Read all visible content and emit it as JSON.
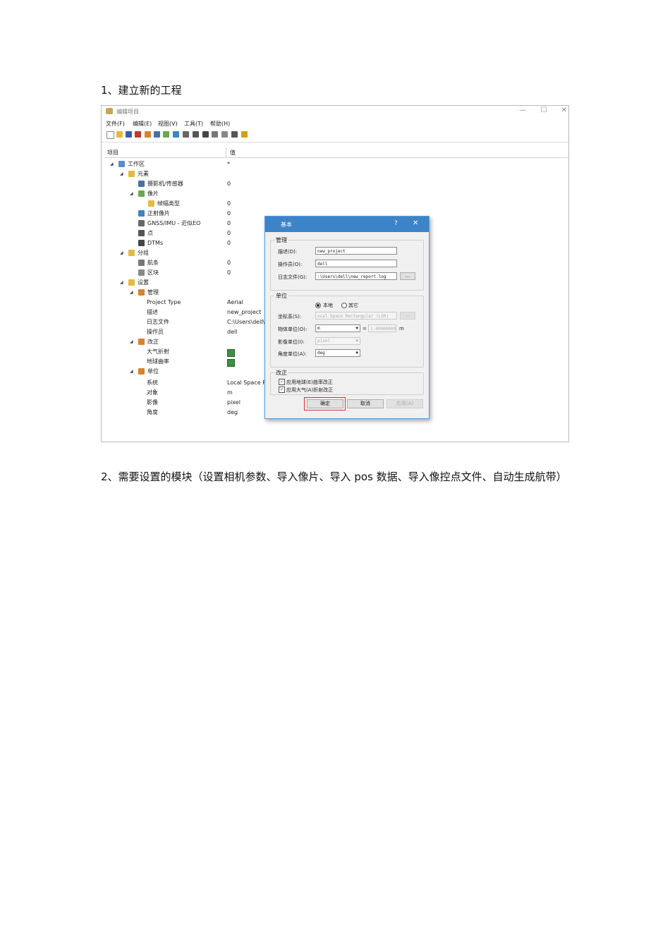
{
  "doc": {
    "para1": "1、建立新的工程",
    "para2": "2、需要设置的模块（设置相机参数、导入像片、导入 pos 数据、导入像控点文件、自动生成航带）"
  },
  "window": {
    "title": "编辑项目",
    "controls": {
      "minimize": "—",
      "maximize": "☐",
      "close": "✕"
    },
    "menu": [
      "文件(F)",
      "编辑(E)",
      "视图(V)",
      "工具(T)",
      "帮助(H)"
    ]
  },
  "tree": {
    "col_item": "项目",
    "col_value": "值",
    "rows": [
      {
        "label": "工作区",
        "value": "*"
      },
      {
        "label": "元素",
        "value": ""
      },
      {
        "label": "摄影机/传感器",
        "value": "0"
      },
      {
        "label": "像片",
        "value": ""
      },
      {
        "label": "帧幅类型",
        "value": "0"
      },
      {
        "label": "正射像片",
        "value": "0"
      },
      {
        "label": "GNSS/IMU - 近似EO",
        "value": "0"
      },
      {
        "label": "点",
        "value": "0"
      },
      {
        "label": "DTMs",
        "value": "0"
      },
      {
        "label": "分组",
        "value": ""
      },
      {
        "label": "航条",
        "value": "0"
      },
      {
        "label": "区块",
        "value": "0"
      },
      {
        "label": "设置",
        "value": ""
      },
      {
        "label": "管理",
        "value": ""
      },
      {
        "label": "Project Type",
        "value": "Aerial"
      },
      {
        "label": "描述",
        "value": "new_project"
      },
      {
        "label": "日志文件",
        "value": "C:\\Users\\dell\\"
      },
      {
        "label": "操作员",
        "value": "dell"
      },
      {
        "label": "改正",
        "value": ""
      },
      {
        "label": "大气折射",
        "value": ""
      },
      {
        "label": "地球曲率",
        "value": ""
      },
      {
        "label": "单位",
        "value": ""
      },
      {
        "label": "系统",
        "value": "Local Space R"
      },
      {
        "label": "对象",
        "value": "m"
      },
      {
        "label": "影像",
        "value": "pixel"
      },
      {
        "label": "角度",
        "value": "deg"
      }
    ]
  },
  "dialog": {
    "title": "基本",
    "help": "?",
    "close": "✕",
    "group_manage": "管理",
    "desc_label": "描述(D):",
    "desc_value": "new_project",
    "operator_label": "操作员(O):",
    "operator_value": "dell",
    "log_label": "日志文件(G):",
    "log_value": ":\\Users\\dell\\new_report.log",
    "browse": "...",
    "group_units": "单位",
    "radio_local": "本地",
    "radio_other": "其它",
    "coord_label": "坐标系(S):",
    "coord_value": "ocal Space Rectangular (LSR)",
    "object_unit_label": "物体单位(O):",
    "object_unit_value": "m",
    "object_unit_factor": "1.00000000",
    "object_unit_suffix": "m",
    "image_unit_label": "影像单位(I):",
    "image_unit_value": "pixel",
    "angle_unit_label": "角度单位(A):",
    "angle_unit_value": "deg",
    "group_correction": "改正",
    "check_earth": "应用地球(E)曲率改正",
    "check_atmos": "应用大气(A)折射改正",
    "ok": "确定",
    "cancel": "取消",
    "apply": "应用(A)"
  }
}
